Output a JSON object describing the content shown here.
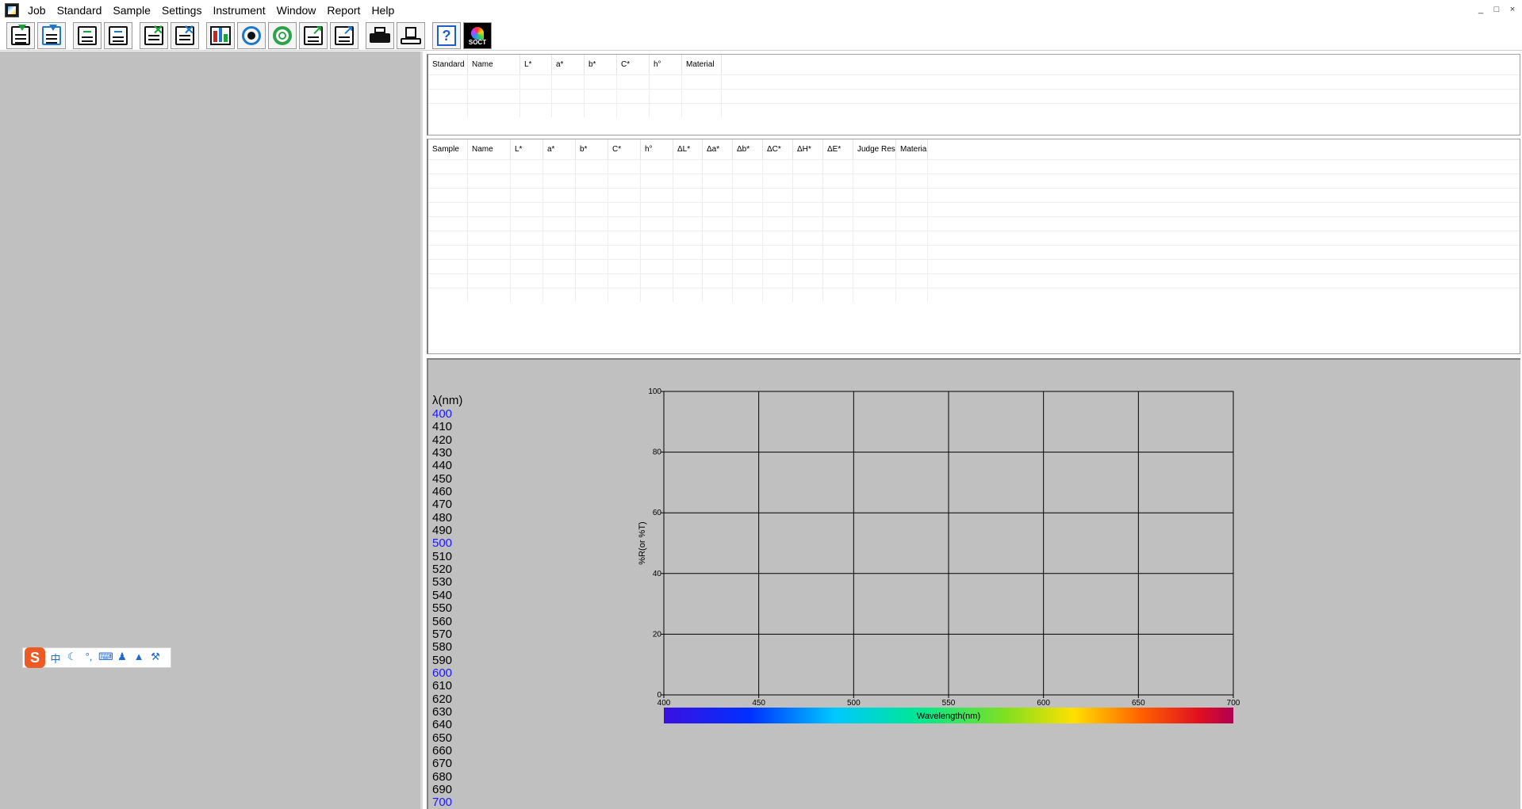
{
  "menu": [
    "Job",
    "Standard",
    "Sample",
    "Settings",
    "Instrument",
    "Window",
    "Report",
    "Help"
  ],
  "window_controls": [
    "_",
    "□",
    "×"
  ],
  "toolbar": {
    "soct_label": "SOCT",
    "help_label": "?"
  },
  "ime": {
    "logo": "S",
    "items": [
      "中",
      "☾",
      "°,",
      "⌨",
      "♟",
      "▲",
      "⚒"
    ]
  },
  "standard_table": {
    "columns": [
      "Standard",
      "Name",
      "L*",
      "a*",
      "b*",
      "C*",
      "h°",
      "Material"
    ],
    "widths": [
      50,
      66,
      40,
      41,
      41,
      41,
      41,
      50
    ],
    "rows": 3
  },
  "sample_table": {
    "columns": [
      "Sample",
      "Name",
      "L*",
      "a*",
      "b*",
      "C*",
      "h°",
      "ΔL*",
      "Δa*",
      "Δb*",
      "ΔC*",
      "ΔH*",
      "ΔE*",
      "Judge Res...",
      "Material"
    ],
    "widths": [
      50,
      54,
      41,
      41,
      41,
      41,
      41,
      37,
      38,
      38,
      38,
      38,
      38,
      54,
      40
    ],
    "rows": 10
  },
  "spectrum": {
    "wavelength_header": "λ(nm)",
    "wavelengths": [
      "400",
      "410",
      "420",
      "430",
      "440",
      "450",
      "460",
      "470",
      "480",
      "490",
      "500",
      "510",
      "520",
      "530",
      "540",
      "550",
      "560",
      "570",
      "580",
      "590",
      "600",
      "610",
      "620",
      "630",
      "640",
      "650",
      "660",
      "670",
      "680",
      "690",
      "700"
    ],
    "highlighted": [
      "400",
      "500",
      "600",
      "700"
    ],
    "highlight_color": "#1a1aff"
  },
  "chart_data": {
    "type": "line",
    "title": "",
    "xlabel": "Wavelength(nm)",
    "ylabel": "%R(or %T)",
    "xlim": [
      400,
      700
    ],
    "ylim": [
      0,
      100
    ],
    "xticks": [
      400,
      450,
      500,
      550,
      600,
      650,
      700
    ],
    "yticks": [
      0,
      20,
      40,
      60,
      80,
      100
    ],
    "grid": true,
    "series": []
  }
}
